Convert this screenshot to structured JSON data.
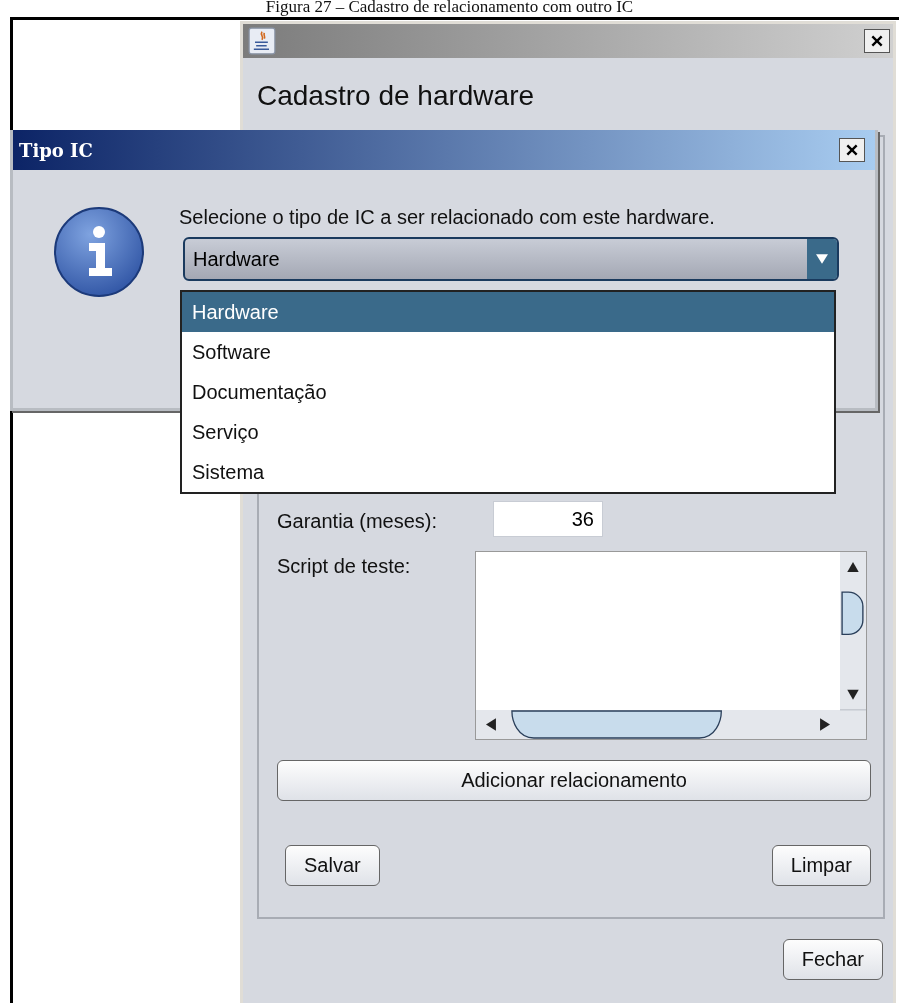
{
  "caption": "Figura 27 – Cadastro de relacionamento com outro IC",
  "main_window": {
    "heading": "Cadastro de hardware",
    "warranty": {
      "label": "Garantia (meses):",
      "value": "36"
    },
    "test_script": {
      "label": "Script de teste:"
    },
    "add_button": "Adicionar relacionamento",
    "buttons": [
      "Salvar",
      "Limpar"
    ],
    "close_button": "Fechar"
  },
  "dialog": {
    "title": "Tipo IC",
    "message": "Selecione o tipo de IC a ser relacionado com este hardware.",
    "combo": {
      "value": "Hardware",
      "expanded": true
    },
    "options": [
      {
        "label": "Hardware",
        "selected": true
      },
      {
        "label": "Software",
        "selected": false
      },
      {
        "label": "Documentação",
        "selected": false
      },
      {
        "label": "Serviço",
        "selected": false
      },
      {
        "label": "Sistema",
        "selected": false
      }
    ]
  }
}
